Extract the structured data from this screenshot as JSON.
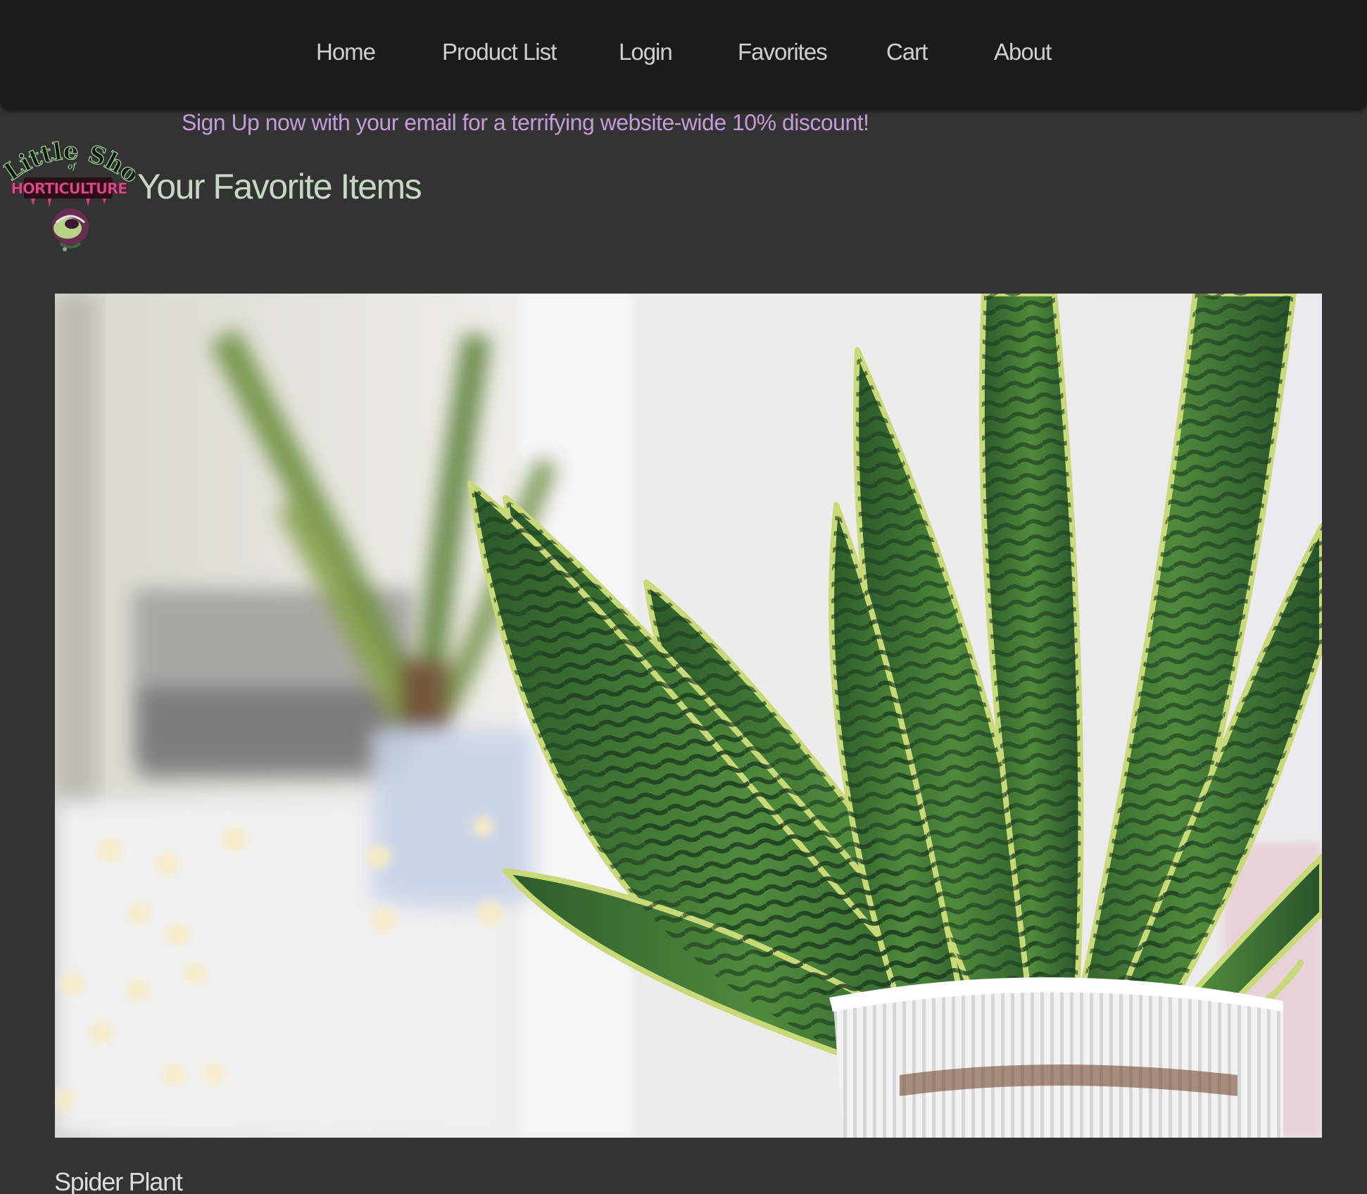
{
  "nav": {
    "items": [
      {
        "label": "Home"
      },
      {
        "label": "Product List"
      },
      {
        "label": "Login"
      },
      {
        "label": "Favorites"
      },
      {
        "label": "Cart"
      },
      {
        "label": "About"
      }
    ]
  },
  "promo": {
    "text": "Sign Up now with your email for a terrifying website-wide 10% discount!",
    "color": "#c39bd9"
  },
  "logo": {
    "line1": "Little Shop",
    "line2": "of",
    "line3": "HORTICULTURE"
  },
  "page": {
    "title": "Your Favorite Items"
  },
  "favorites": [
    {
      "name": "Spider Plant",
      "image": "snake-plant-photo"
    }
  ],
  "colors": {
    "background": "#333333",
    "navbar": "#1b1b1b",
    "title": "#c7d8c2"
  }
}
